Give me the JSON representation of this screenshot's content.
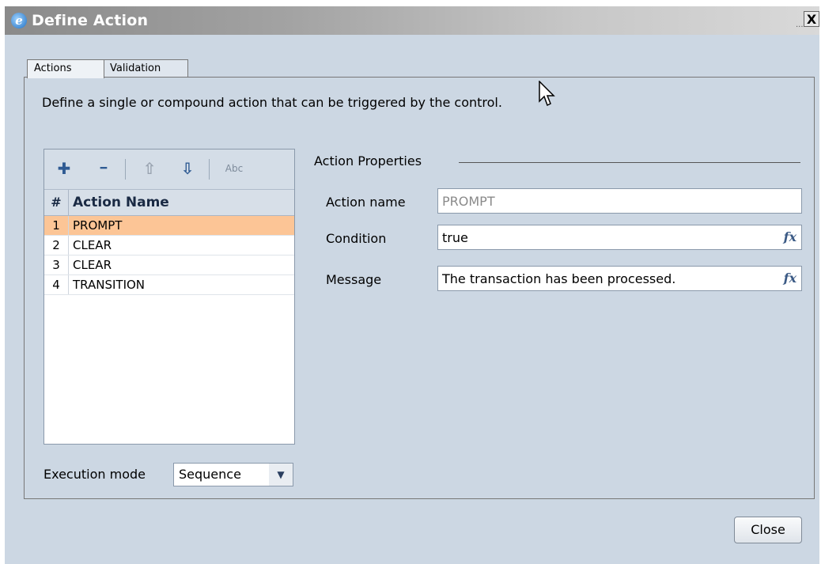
{
  "window": {
    "title": "Define Action",
    "title_dots": "...",
    "close_glyph": "X"
  },
  "tabs": [
    {
      "label": "Actions",
      "active": true
    },
    {
      "label": "Validation",
      "active": false
    }
  ],
  "description": "Define a single or compound action that can be triggered by the control.",
  "toolbar": {
    "add_icon": "✚",
    "remove_icon": "━",
    "up_icon": "⇧",
    "down_icon": "⇩",
    "rename_icon": "Abc"
  },
  "list": {
    "headers": {
      "num": "#",
      "name": "Action Name"
    },
    "rows": [
      {
        "num": "1",
        "name": "PROMPT",
        "selected": true
      },
      {
        "num": "2",
        "name": "CLEAR",
        "selected": false
      },
      {
        "num": "3",
        "name": "CLEAR",
        "selected": false
      },
      {
        "num": "4",
        "name": "TRANSITION",
        "selected": false
      }
    ]
  },
  "execution_mode": {
    "label": "Execution mode",
    "value": "Sequence",
    "arrow": "▼"
  },
  "properties": {
    "group_title": "Action Properties",
    "action_name": {
      "label": "Action name",
      "value": "PROMPT"
    },
    "condition": {
      "label": "Condition",
      "value": "true",
      "fx": "fx"
    },
    "message": {
      "label": "Message",
      "value": "The transaction has been processed.",
      "fx": "fx"
    }
  },
  "buttons": {
    "close": "Close"
  },
  "colors": {
    "selected_row": "#fcc596",
    "dialog_bg": "#ccd7e3"
  }
}
